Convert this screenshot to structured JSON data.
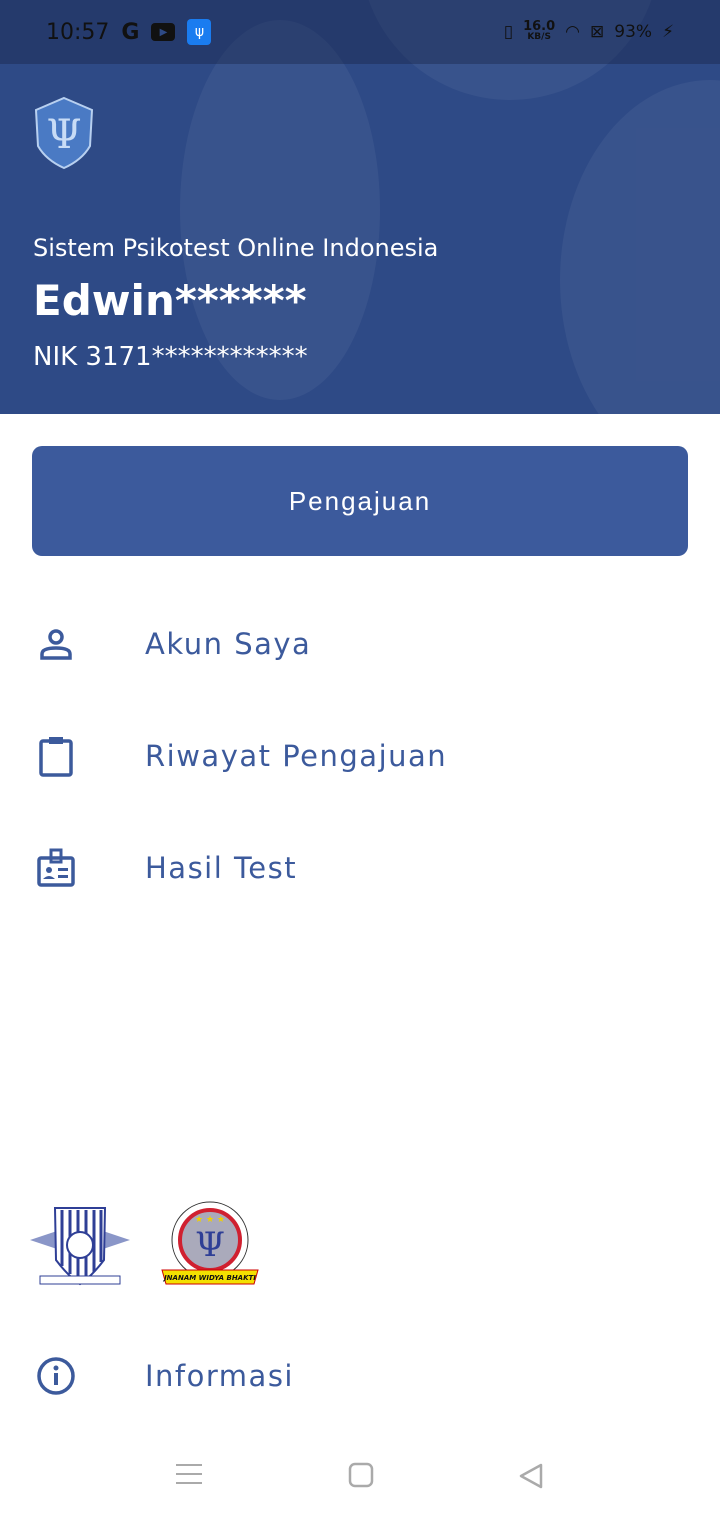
{
  "status_bar": {
    "time": "10:57",
    "net_speed": "16.0",
    "net_unit": "KB/S",
    "battery": "93%"
  },
  "header": {
    "app_subtitle": "Sistem Psikotest Online Indonesia",
    "user_name": "Edwin******",
    "nik": "NIK 3171************"
  },
  "primary_button": "Pengajuan",
  "menu": [
    {
      "label": "Akun Saya",
      "icon": "person-icon"
    },
    {
      "label": "Riwayat Pengajuan",
      "icon": "clipboard-icon"
    },
    {
      "label": "Hasil Test",
      "icon": "id-badge-icon"
    }
  ],
  "footer_logos": {
    "logo2_text": "JNANAM WIDYA BHAKTI"
  },
  "info_item": {
    "label": "Informasi",
    "icon": "info-icon"
  },
  "colors": {
    "primary": "#3c5a9c",
    "header": "#2e4a86"
  }
}
